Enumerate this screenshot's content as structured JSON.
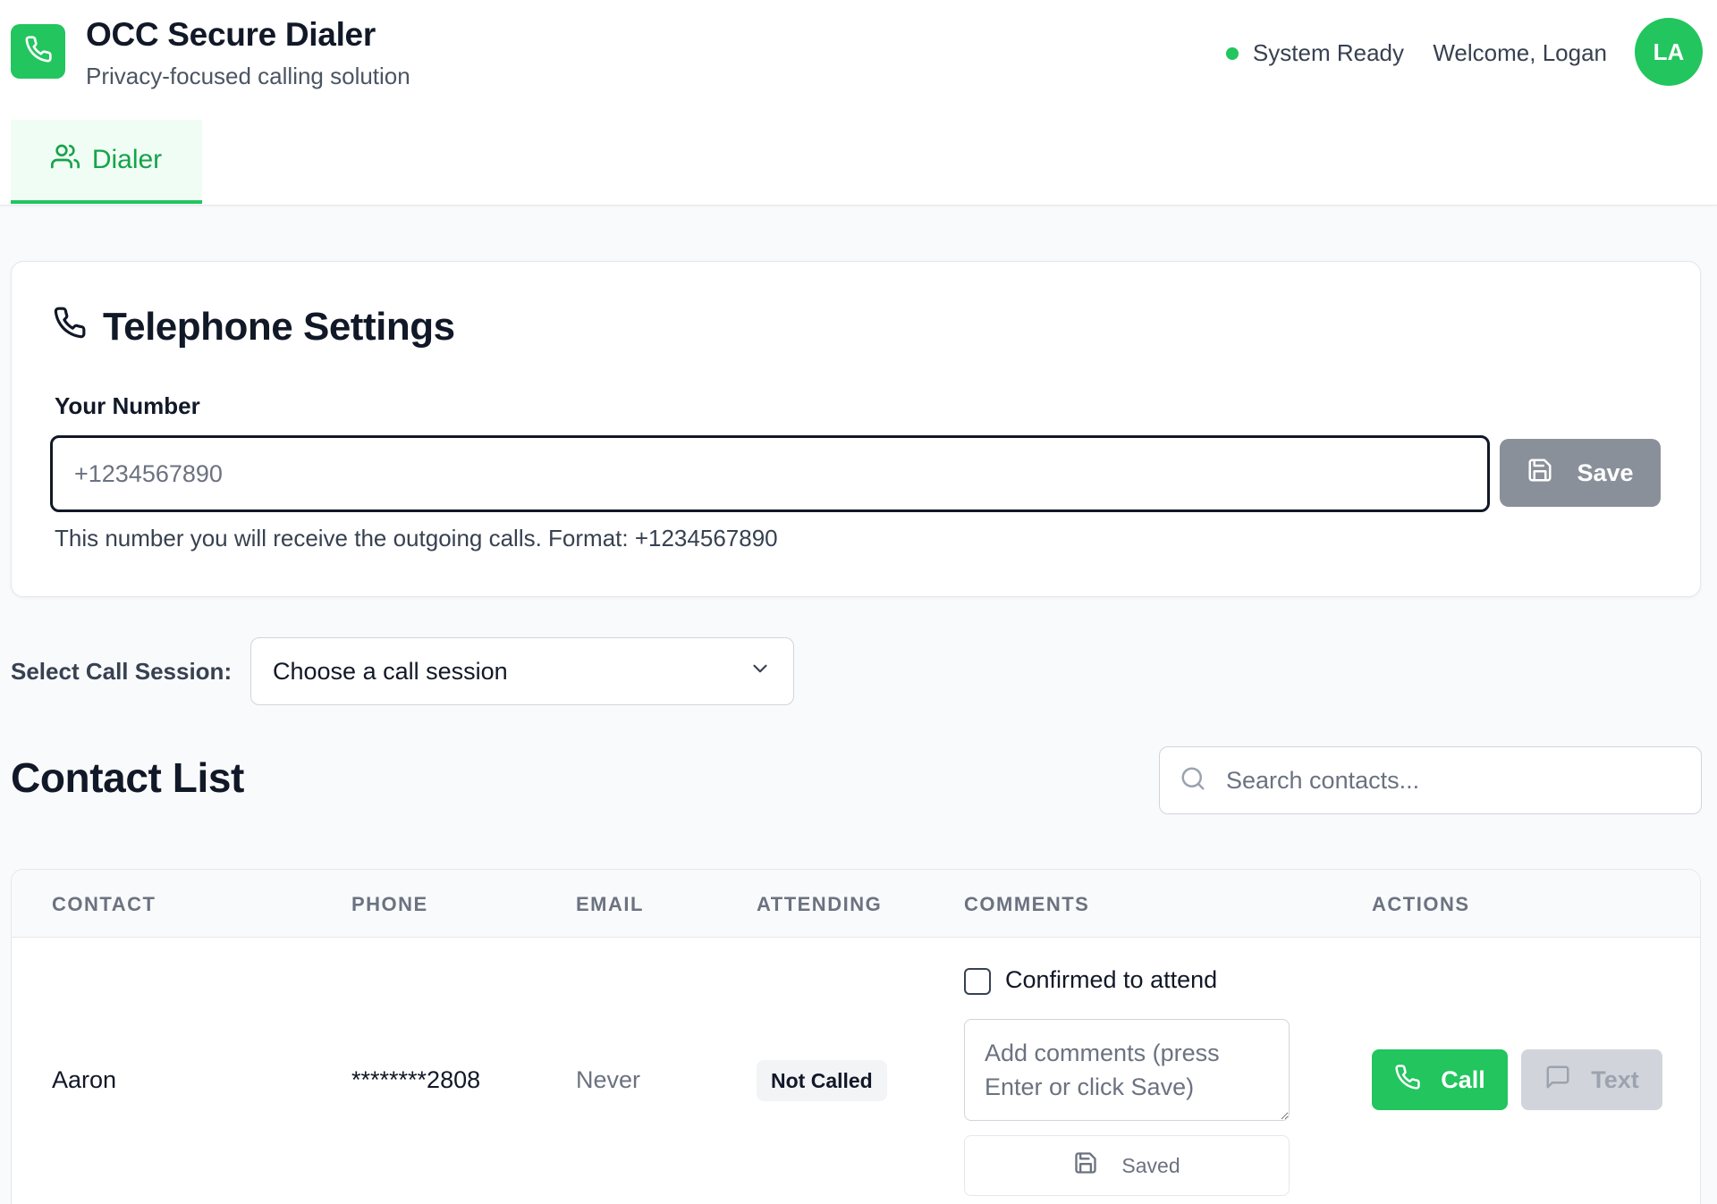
{
  "app": {
    "title": "OCC Secure Dialer",
    "subtitle": "Privacy-focused calling solution",
    "logo_icon": "phone-icon",
    "accent_color": "#22c55e"
  },
  "header": {
    "status_text": "System Ready",
    "welcome_text": "Welcome, Logan",
    "avatar_initials": "LA"
  },
  "tabs": [
    {
      "label": "Dialer",
      "icon": "users-icon",
      "active": true
    }
  ],
  "telephone_settings": {
    "title": "Telephone Settings",
    "field_label": "Your Number",
    "input_value": "",
    "input_placeholder": "+1234567890",
    "save_label": "Save",
    "helper_text": "This number you will receive the outgoing calls. Format: +1234567890"
  },
  "session": {
    "label": "Select Call Session:",
    "selected": "Choose a call session"
  },
  "contacts": {
    "title": "Contact List",
    "search_placeholder": "Search contacts...",
    "columns": [
      "CONTACT",
      "PHONE",
      "EMAIL",
      "ATTENDING",
      "COMMENTS",
      "ACTIONS"
    ],
    "rows": [
      {
        "name": "Aaron",
        "phone": "********2808",
        "email": "Never",
        "attending": "Not Called",
        "confirm_label": "Confirmed to attend",
        "confirmed": false,
        "comment_value": "",
        "comment_placeholder": "Add comments (press Enter or click Save)",
        "saved_label": "Saved",
        "call_label": "Call",
        "text_label": "Text"
      }
    ]
  }
}
